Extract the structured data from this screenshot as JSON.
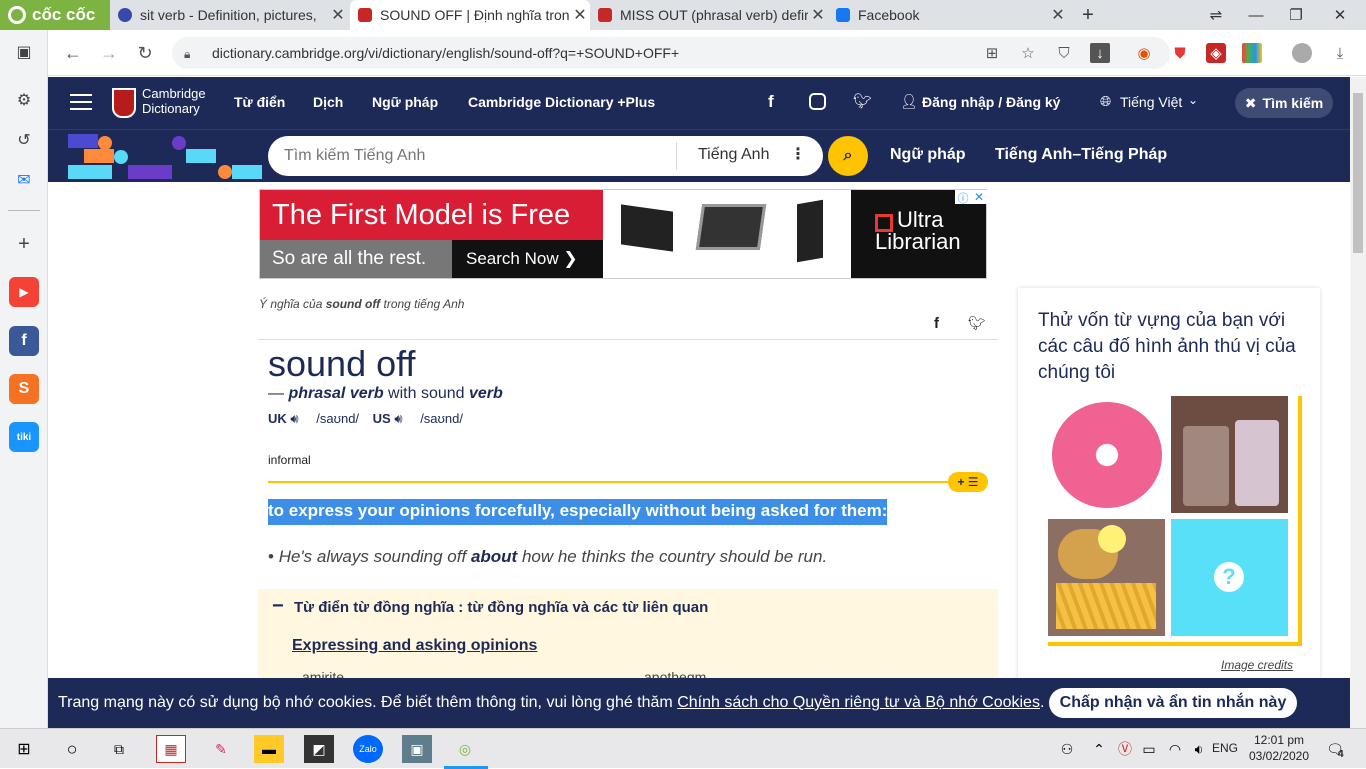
{
  "browser": {
    "name": "cốc cốc",
    "tabs": [
      {
        "title": "sit verb - Definition, pictures,",
        "color": "#3949ab"
      },
      {
        "title": "SOUND OFF | Định nghĩa tron",
        "color": "#c62828"
      },
      {
        "title": "MISS OUT (phrasal verb) defir",
        "color": "#c62828"
      },
      {
        "title": "Facebook",
        "color": "#1877f2"
      }
    ],
    "url": "dictionary.cambridge.org/vi/dictionary/english/sound-off?q=+SOUND+OFF+"
  },
  "site": {
    "logo": [
      "Cambridge",
      "Dictionary"
    ],
    "nav": [
      "Từ điển",
      "Dịch",
      "Ngữ pháp",
      "Cambridge Dictionary +Plus"
    ],
    "login": "Đăng nhập / Đăng ký",
    "language": "Tiếng Việt",
    "search_toggle": "Tìm kiếm",
    "search_placeholder": "Tìm kiếm Tiếng Anh",
    "search_lang": "Tiếng Anh",
    "nav2": [
      "Ngữ pháp",
      "Tiếng Anh–Tiếng Pháp"
    ]
  },
  "ad": {
    "headline": "The First Model is Free",
    "sub": "So are all the rest.",
    "cta": "Search Now ❯",
    "brand": [
      "Ultra",
      "Librarian"
    ]
  },
  "entry": {
    "meaning_of_prefix": "Ý nghĩa của ",
    "meaning_of_word": "sound off",
    "meaning_of_suffix": " trong tiếng Anh",
    "headword": "sound off",
    "pos_dash": "— ",
    "pos": "phrasal verb",
    "pos_with": " with sound ",
    "pos_base": "verb",
    "uk": "UK",
    "uk_ipa": "/saʊnd/",
    "us": "US",
    "us_ipa": "/saʊnd/",
    "register": "informal",
    "definition": "to express your opinions forcefully, especially without being asked for them:",
    "example_before": "He's always sounding off ",
    "example_bold": "about",
    "example_after": " how he thinks the country should be run.",
    "thesaurus_title": "Từ điển từ đồng nghĩa : từ đồng nghĩa và các từ liên quan",
    "thesaurus_link": "Expressing and asking opinions",
    "related": [
      "amirite",
      "apothegm"
    ]
  },
  "quiz": {
    "title": "Thử vốn từ vựng của bạn với các câu đố hình ảnh thú vị của chúng tôi",
    "credits": "Image credits",
    "unknown": "?"
  },
  "cookie": {
    "text": "Trang mạng này có sử dụng bộ nhớ cookies. Để biết thêm thông tin, vui lòng ghé thăm ",
    "link": "Chính sách cho Quyền riêng tư và Bộ nhớ Cookies",
    "end": ".",
    "button": "Chấp nhận và ẩn tin nhắn này"
  },
  "taskbar": {
    "language": "ENG",
    "time": "12:01 pm",
    "date": "03/02/2020",
    "notif_count": "4"
  }
}
